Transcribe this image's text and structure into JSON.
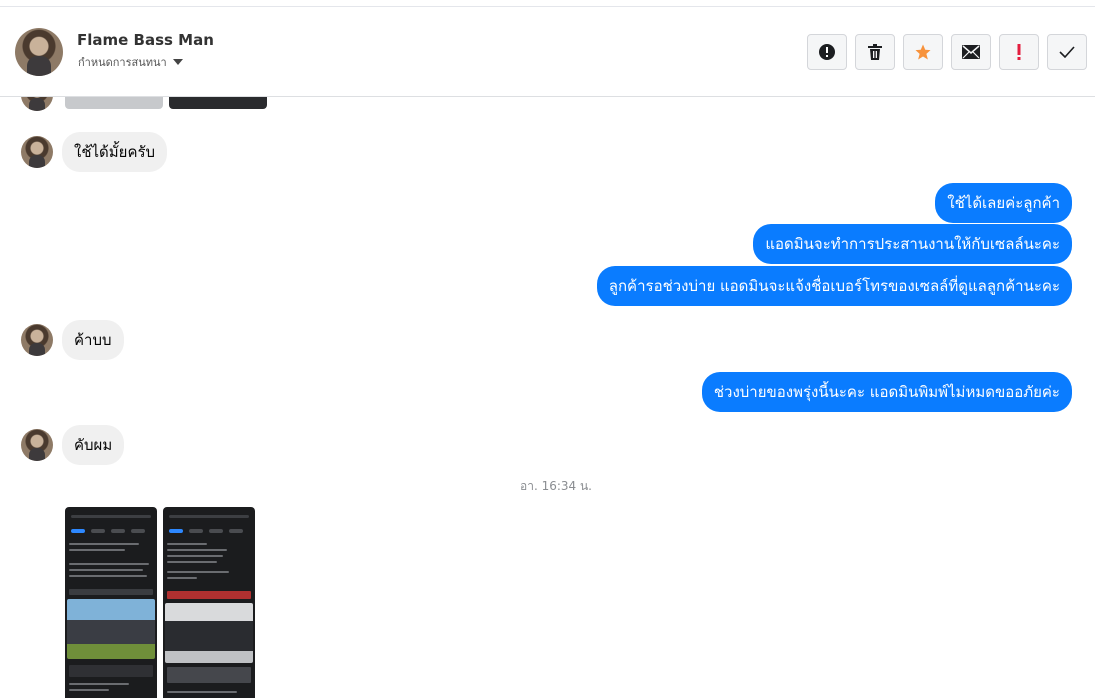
{
  "header": {
    "contact_name": "Flame Bass Man",
    "subtitle": "กำหนดการสนทนา",
    "actions": [
      {
        "name": "report-icon",
        "glyph": "!"
      },
      {
        "name": "trash-icon",
        "glyph": "🗑"
      },
      {
        "name": "star-icon",
        "glyph": "★",
        "color": "#f7923b"
      },
      {
        "name": "mail-icon",
        "glyph": "✉"
      },
      {
        "name": "priority-icon",
        "glyph": "!",
        "color": "#e41e3f"
      },
      {
        "name": "check-icon",
        "glyph": "✓"
      }
    ]
  },
  "messages": {
    "in_1": "ใช้ได้มั้ยครับ",
    "out_1": "ใช้ได้เลยค่ะลูกค้า",
    "out_2": "แอดมินจะทำการประสานงานให้กับเซลล์นะคะ",
    "out_3": "ลูกค้ารอช่วงบ่าย แอดมินจะแจ้งชื่อเบอร์โทรของเซลล์ที่ดูแลลูกค้านะคะ",
    "in_2": "ค้าบบ",
    "out_4": "ช่วงบ่ายของพรุ่งนี้นะคะ แอดมินพิมพ์ไม่หมดขออภัยค่ะ",
    "in_3": "คับผม",
    "timestamp": "อา. 16:34 น."
  },
  "colors": {
    "outgoing_bubble": "#0a7cff",
    "incoming_bubble": "#f0f0f0"
  }
}
